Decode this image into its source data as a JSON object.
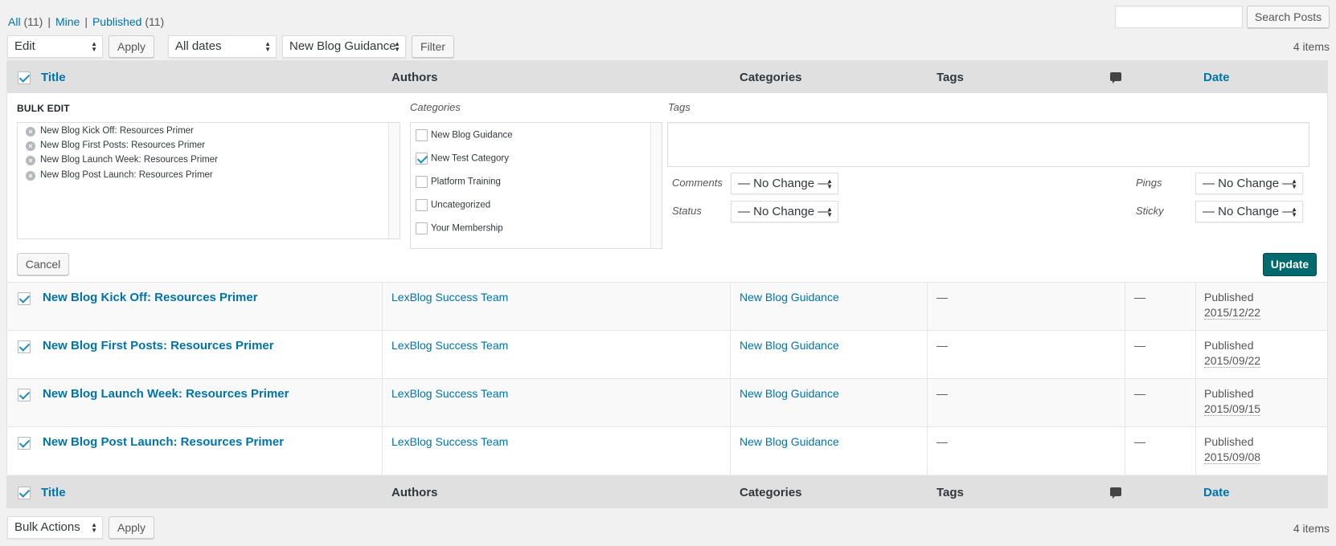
{
  "views": {
    "all_label": "All",
    "all_count": "(11)",
    "mine_label": "Mine",
    "published_label": "Published",
    "published_count": "(11)"
  },
  "search": {
    "button": "Search Posts",
    "value": ""
  },
  "toolbar": {
    "action_value": "Edit",
    "apply": "Apply",
    "dates_value": "All dates",
    "category_value": "New Blog Guidance",
    "filter": "Filter",
    "items": "4 items"
  },
  "columns": {
    "title": "Title",
    "authors": "Authors",
    "categories": "Categories",
    "tags": "Tags",
    "date": "Date"
  },
  "bulk_edit": {
    "heading": "BULK EDIT",
    "titles": [
      "New Blog Kick Off: Resources Primer",
      "New Blog First Posts: Resources Primer",
      "New Blog Launch Week: Resources Primer",
      "New Blog Post Launch: Resources Primer"
    ],
    "categories_label": "Categories",
    "categories": [
      {
        "label": "New Blog Guidance",
        "checked": false
      },
      {
        "label": "New Test Category",
        "checked": true
      },
      {
        "label": "Platform Training",
        "checked": false
      },
      {
        "label": "Uncategorized",
        "checked": false
      },
      {
        "label": "Your Membership",
        "checked": false
      }
    ],
    "tags_label": "Tags",
    "comments_label": "Comments",
    "comments_value": "— No Change —",
    "status_label": "Status",
    "status_value": "— No Change —",
    "pings_label": "Pings",
    "pings_value": "— No Change —",
    "sticky_label": "Sticky",
    "sticky_value": "— No Change —",
    "cancel": "Cancel",
    "update": "Update"
  },
  "rows": [
    {
      "title": "New Blog Kick Off: Resources Primer",
      "author": "LexBlog Success Team",
      "category": "New Blog Guidance",
      "tags": "—",
      "comments": "—",
      "status": "Published",
      "date": "2015/12/22"
    },
    {
      "title": "New Blog First Posts: Resources Primer",
      "author": "LexBlog Success Team",
      "category": "New Blog Guidance",
      "tags": "—",
      "comments": "—",
      "status": "Published",
      "date": "2015/09/22"
    },
    {
      "title": "New Blog Launch Week: Resources Primer",
      "author": "LexBlog Success Team",
      "category": "New Blog Guidance",
      "tags": "—",
      "comments": "—",
      "status": "Published",
      "date": "2015/09/15"
    },
    {
      "title": "New Blog Post Launch: Resources Primer",
      "author": "LexBlog Success Team",
      "category": "New Blog Guidance",
      "tags": "—",
      "comments": "—",
      "status": "Published",
      "date": "2015/09/08"
    }
  ],
  "bottom": {
    "action_value": "Bulk Actions",
    "apply": "Apply",
    "items": "4 items"
  },
  "icons": {
    "checkbox": "checkbox-icon",
    "comments": "comment-bubble-icon",
    "remove": "remove-circle-icon"
  },
  "colors": {
    "link": "#0073aa",
    "update_button": "#006a6f",
    "header_bg": "#e0e0e0",
    "page_bg": "#f1f1f1"
  }
}
